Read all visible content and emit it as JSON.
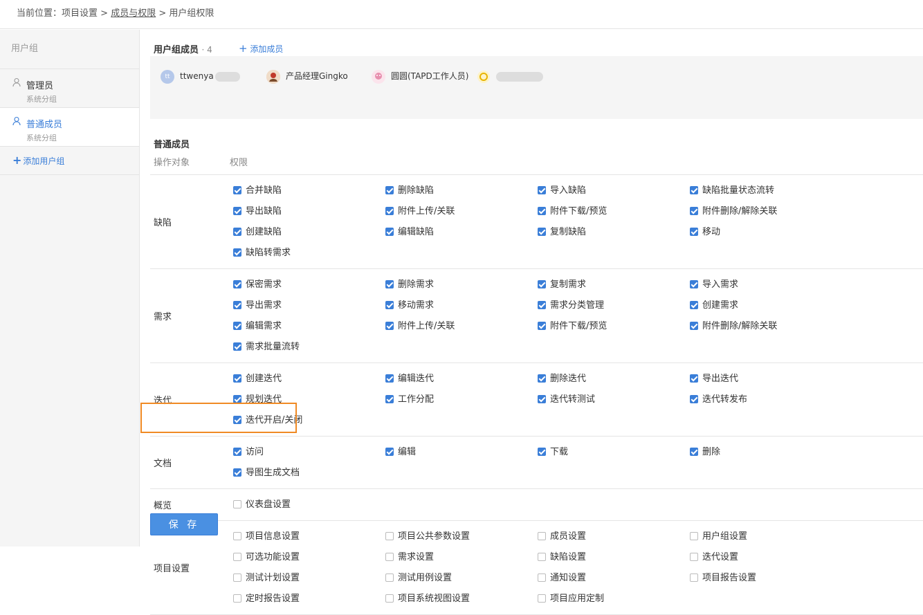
{
  "breadcrumb": {
    "prefix": "当前位置：",
    "item1": "项目设置",
    "sep": " > ",
    "item2": "成员与权限",
    "item3": "用户组权限"
  },
  "sidebar": {
    "header": "用户组",
    "groups": [
      {
        "name": "管理员",
        "sub": "系统分组"
      },
      {
        "name": "普通成员",
        "sub": "系统分组"
      }
    ],
    "add_label": "添加用户组"
  },
  "members": {
    "title": "用户组成员",
    "count": "· 4",
    "add_label": "添加成员",
    "list": [
      {
        "avatar_text": "tt",
        "name": "ttwenya"
      },
      {
        "name": "产品经理Gingko"
      },
      {
        "name": "圆圆(TAPD工作人员)"
      },
      {
        "name": ""
      }
    ]
  },
  "section": {
    "title": "普通成员",
    "col_object": "操作对象",
    "col_perm": "权限"
  },
  "permissions": [
    {
      "object": "缺陷",
      "items": [
        {
          "label": "合并缺陷",
          "checked": true
        },
        {
          "label": "删除缺陷",
          "checked": true
        },
        {
          "label": "导入缺陷",
          "checked": true
        },
        {
          "label": "缺陷批量状态流转",
          "checked": true
        },
        {
          "label": "导出缺陷",
          "checked": true
        },
        {
          "label": "附件上传/关联",
          "checked": true
        },
        {
          "label": "附件下载/预览",
          "checked": true
        },
        {
          "label": "附件删除/解除关联",
          "checked": true
        },
        {
          "label": "创建缺陷",
          "checked": true
        },
        {
          "label": "编辑缺陷",
          "checked": true
        },
        {
          "label": "复制缺陷",
          "checked": true
        },
        {
          "label": "移动",
          "checked": true
        },
        {
          "label": "缺陷转需求",
          "checked": true
        }
      ]
    },
    {
      "object": "需求",
      "items": [
        {
          "label": "保密需求",
          "checked": true
        },
        {
          "label": "删除需求",
          "checked": true
        },
        {
          "label": "复制需求",
          "checked": true
        },
        {
          "label": "导入需求",
          "checked": true
        },
        {
          "label": "导出需求",
          "checked": true
        },
        {
          "label": "移动需求",
          "checked": true
        },
        {
          "label": "需求分类管理",
          "checked": true
        },
        {
          "label": "创建需求",
          "checked": true
        },
        {
          "label": "编辑需求",
          "checked": true
        },
        {
          "label": "附件上传/关联",
          "checked": true
        },
        {
          "label": "附件下载/预览",
          "checked": true
        },
        {
          "label": "附件删除/解除关联",
          "checked": true
        },
        {
          "label": "需求批量流转",
          "checked": true
        }
      ]
    },
    {
      "object": "迭代",
      "items": [
        {
          "label": "创建迭代",
          "checked": true
        },
        {
          "label": "编辑迭代",
          "checked": true
        },
        {
          "label": "删除迭代",
          "checked": true
        },
        {
          "label": "导出迭代",
          "checked": true
        },
        {
          "label": "规划迭代",
          "checked": true
        },
        {
          "label": "工作分配",
          "checked": true
        },
        {
          "label": "迭代转测试",
          "checked": true
        },
        {
          "label": "迭代转发布",
          "checked": true
        },
        {
          "label": "迭代开启/关闭",
          "checked": true
        }
      ]
    },
    {
      "object": "文档",
      "items": [
        {
          "label": "访问",
          "checked": true
        },
        {
          "label": "编辑",
          "checked": true
        },
        {
          "label": "下载",
          "checked": true
        },
        {
          "label": "删除",
          "checked": true
        },
        {
          "label": "导图生成文档",
          "checked": true
        }
      ]
    },
    {
      "object": "概览",
      "items": [
        {
          "label": "仪表盘设置",
          "checked": false
        }
      ]
    },
    {
      "object": "项目设置",
      "items": [
        {
          "label": "项目信息设置",
          "checked": false
        },
        {
          "label": "项目公共参数设置",
          "checked": false
        },
        {
          "label": "成员设置",
          "checked": false
        },
        {
          "label": "用户组设置",
          "checked": false
        },
        {
          "label": "可选功能设置",
          "checked": false
        },
        {
          "label": "需求设置",
          "checked": false
        },
        {
          "label": "缺陷设置",
          "checked": false
        },
        {
          "label": "迭代设置",
          "checked": false
        },
        {
          "label": "测试计划设置",
          "checked": false
        },
        {
          "label": "测试用例设置",
          "checked": false
        },
        {
          "label": "通知设置",
          "checked": false
        },
        {
          "label": "项目报告设置",
          "checked": false
        },
        {
          "label": "定时报告设置",
          "checked": false
        },
        {
          "label": "项目系统视图设置",
          "checked": false
        },
        {
          "label": "项目应用定制",
          "checked": false
        }
      ]
    }
  ],
  "save_label": "保 存",
  "colors": {
    "accent": "#3a7ed8",
    "highlight": "#f08a24"
  }
}
